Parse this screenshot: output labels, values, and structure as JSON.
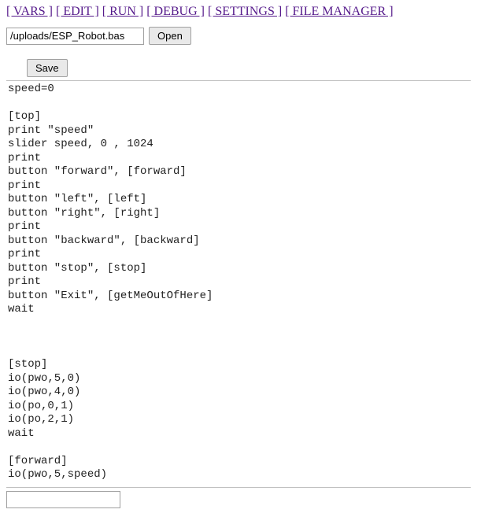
{
  "nav": {
    "vars": "[ VARS ]",
    "edit": "[ EDIT ]",
    "run": "[ RUN ]",
    "debug": "[ DEBUG ]",
    "settings": "[ SETTINGS ]",
    "file_manager": "[ FILE MANAGER ]"
  },
  "filebar": {
    "path": "/uploads/ESP_Robot.bas",
    "open_label": "Open"
  },
  "toolbar": {
    "save_label": "Save"
  },
  "code": "speed=0\n\n[top]\nprint \"speed\"\nslider speed, 0 , 1024\nprint\nbutton \"forward\", [forward]\nprint\nbutton \"left\", [left]\nbutton \"right\", [right]\nprint\nbutton \"backward\", [backward]\nprint\nbutton \"stop\", [stop]\nprint\nbutton \"Exit\", [getMeOutOfHere]\nwait\n\n\n\n[stop]\nio(pwo,5,0)\nio(pwo,4,0)\nio(po,0,1)\nio(po,2,1)\nwait\n\n[forward]\nio(pwo,5,speed)",
  "footer": {
    "input_value": ""
  }
}
